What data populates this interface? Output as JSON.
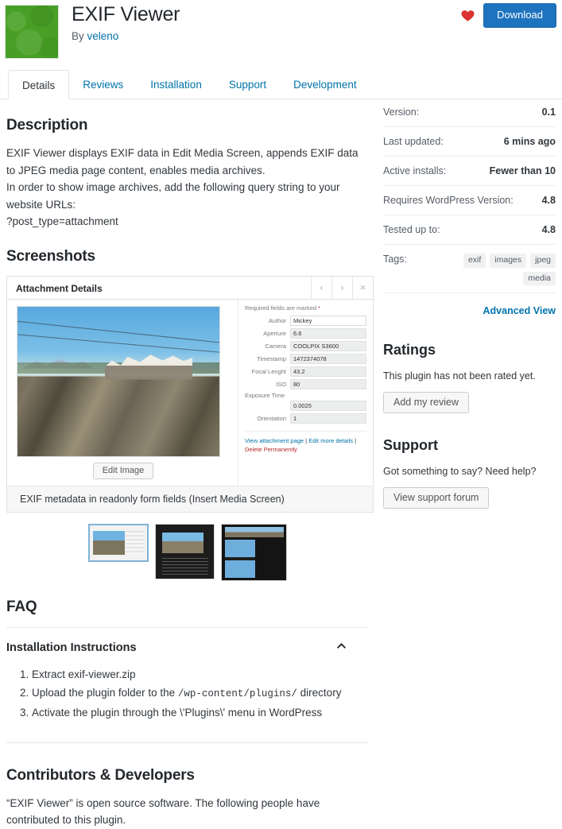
{
  "header": {
    "plugin_name": "EXIF Viewer",
    "by_prefix": "By ",
    "author": "veleno",
    "favorite_icon": "heart-icon",
    "download_label": "Download",
    "icon_color": "#47a025",
    "accent_color": "#0073aa",
    "download_bg": "#1e73be",
    "heart_color": "#dc3232"
  },
  "tabs": [
    {
      "label": "Details",
      "active": true
    },
    {
      "label": "Reviews",
      "active": false
    },
    {
      "label": "Installation",
      "active": false
    },
    {
      "label": "Support",
      "active": false
    },
    {
      "label": "Development",
      "active": false
    }
  ],
  "description": {
    "heading": "Description",
    "line1": "EXIF Viewer displays EXIF data in Edit Media Screen, appends EXIF data to JPEG media page content, enables media archives.",
    "line2": "In order to show image archives, add the following query string to your website URLs:",
    "line3": "?post_type=attachment"
  },
  "screenshots": {
    "heading": "Screenshots",
    "panel": {
      "title": "Attachment Details",
      "prev_icon": "chevron-left-icon",
      "next_icon": "chevron-right-icon",
      "close_icon": "close-icon",
      "required_note": "Required fields are marked ",
      "required_star": "*",
      "edit_image_label": "Edit Image",
      "fields": [
        {
          "label": "Author",
          "value": "Mickey",
          "focused": true
        },
        {
          "label": "Aperture",
          "value": "6.6",
          "focused": false
        },
        {
          "label": "Camera",
          "value": "COOLPIX S3600",
          "focused": false
        },
        {
          "label": "Timestamp",
          "value": "1472374078",
          "focused": false
        },
        {
          "label": "Focal Lenght",
          "value": "43.2",
          "focused": false
        },
        {
          "label": "ISO",
          "value": "80",
          "focused": false
        }
      ],
      "stacked_field": {
        "label": "Exposure Time",
        "value": "0.0025"
      },
      "orientation_field": {
        "label": "Orientation",
        "value": "1"
      },
      "links": {
        "view_attachment": "View attachment page",
        "sep1": " | ",
        "edit_more": "Edit more details",
        "sep2": " | ",
        "delete": "Delete Permanently"
      }
    },
    "caption": "EXIF metadata in readonly form fields (Insert Media Screen)",
    "thumbnails": [
      {
        "name": "thumbnail-1",
        "selected": true
      },
      {
        "name": "thumbnail-2",
        "selected": false
      },
      {
        "name": "thumbnail-3",
        "selected": false
      }
    ]
  },
  "faq": {
    "heading": "FAQ",
    "question": "Installation Instructions",
    "toggle_icon": "chevron-up-icon",
    "steps": [
      {
        "pre": "Extract exif-viewer.zip",
        "code": "",
        "post": ""
      },
      {
        "pre": "Upload the plugin folder to the ",
        "code": "/wp-content/plugins/",
        "post": " directory"
      },
      {
        "pre": "Activate the plugin through the \\'Plugins\\' menu in WordPress",
        "code": "",
        "post": ""
      }
    ]
  },
  "contributors": {
    "heading": "Contributors & Developers",
    "text": "“EXIF Viewer” is open source software. The following people have contributed to this plugin."
  },
  "sidebar": {
    "meta": [
      {
        "key": "Version:",
        "value": "0.1"
      },
      {
        "key": "Last updated:",
        "value": "6 mins ago"
      },
      {
        "key": "Active installs:",
        "value": "Fewer than 10"
      },
      {
        "key": "Requires WordPress Version:",
        "value": "4.8"
      },
      {
        "key": "Tested up to:",
        "value": "4.8"
      }
    ],
    "tags_label": "Tags:",
    "tags": [
      "exif",
      "images",
      "jpeg",
      "media"
    ],
    "advanced_view": "Advanced View",
    "ratings": {
      "heading": "Ratings",
      "text": "This plugin has not been rated yet.",
      "button": "Add my review"
    },
    "support": {
      "heading": "Support",
      "text": "Got something to say? Need help?",
      "button": "View support forum"
    }
  }
}
